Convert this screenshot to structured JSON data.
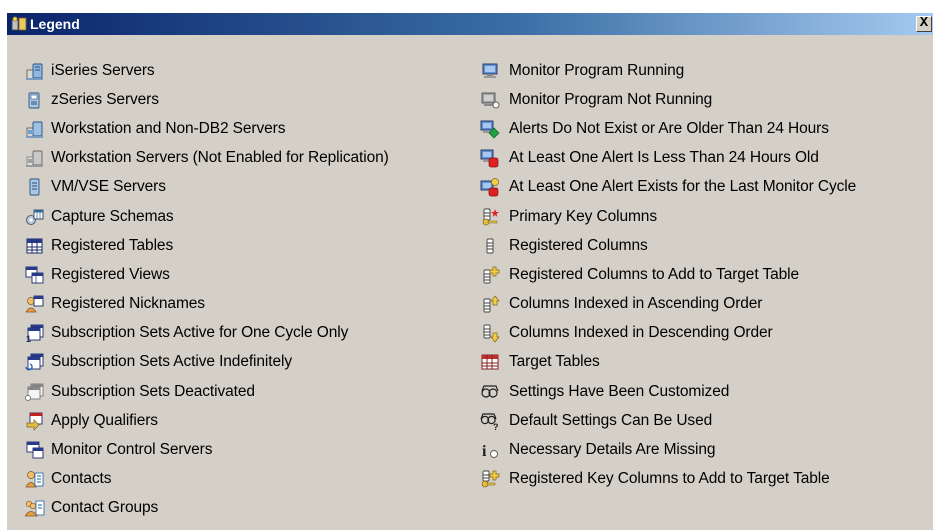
{
  "window": {
    "title": "Legend",
    "close_label": "X"
  },
  "left_items": [
    {
      "icon": "iseries-server-icon",
      "label": "iSeries Servers"
    },
    {
      "icon": "zseries-server-icon",
      "label": "zSeries Servers"
    },
    {
      "icon": "workstation-server-icon",
      "label": "Workstation and Non-DB2 Servers"
    },
    {
      "icon": "workstation-disabled-icon",
      "label": "Workstation Servers (Not Enabled for Replication)"
    },
    {
      "icon": "vmvse-server-icon",
      "label": "VM/VSE Servers"
    },
    {
      "icon": "capture-schema-icon",
      "label": "Capture Schemas"
    },
    {
      "icon": "registered-table-icon",
      "label": "Registered Tables"
    },
    {
      "icon": "registered-view-icon",
      "label": "Registered Views"
    },
    {
      "icon": "registered-nickname-icon",
      "label": "Registered Nicknames"
    },
    {
      "icon": "subscription-set-once-icon",
      "label": "Subscription Sets Active for One Cycle Only"
    },
    {
      "icon": "subscription-set-indefinite-icon",
      "label": "Subscription Sets Active Indefinitely"
    },
    {
      "icon": "subscription-set-deactivated-icon",
      "label": "Subscription Sets Deactivated"
    },
    {
      "icon": "apply-qualifier-icon",
      "label": "Apply Qualifiers"
    },
    {
      "icon": "monitor-control-server-icon",
      "label": "Monitor Control Servers"
    },
    {
      "icon": "contact-icon",
      "label": "Contacts"
    },
    {
      "icon": "contact-group-icon",
      "label": "Contact Groups"
    }
  ],
  "right_items": [
    {
      "icon": "monitor-running-icon",
      "label": "Monitor Program Running"
    },
    {
      "icon": "monitor-not-running-icon",
      "label": "Monitor Program Not Running"
    },
    {
      "icon": "alerts-old-icon",
      "label": "Alerts Do Not Exist or Are Older Than 24 Hours"
    },
    {
      "icon": "alert-recent-icon",
      "label": "At Least One Alert Is Less Than 24 Hours Old"
    },
    {
      "icon": "alert-last-cycle-icon",
      "label": "At Least One Alert Exists for the Last Monitor Cycle"
    },
    {
      "icon": "primary-key-column-icon",
      "label": "Primary Key Columns"
    },
    {
      "icon": "registered-column-icon",
      "label": "Registered Columns"
    },
    {
      "icon": "column-add-target-icon",
      "label": "Registered Columns to Add to Target Table"
    },
    {
      "icon": "column-index-ascending-icon",
      "label": "Columns Indexed in Ascending Order"
    },
    {
      "icon": "column-index-descending-icon",
      "label": "Columns Indexed in Descending Order"
    },
    {
      "icon": "target-table-icon",
      "label": "Target Tables"
    },
    {
      "icon": "settings-customized-icon",
      "label": "Settings Have Been Customized"
    },
    {
      "icon": "settings-default-icon",
      "label": "Default Settings Can Be Used"
    },
    {
      "icon": "details-missing-icon",
      "label": "Necessary Details Are Missing"
    },
    {
      "icon": "key-column-add-target-icon",
      "label": "Registered Key Columns to Add to Target Table"
    }
  ],
  "colors": {
    "title_start": "#0a246a",
    "title_end": "#a6caf0",
    "panel": "#d4d0c8"
  }
}
